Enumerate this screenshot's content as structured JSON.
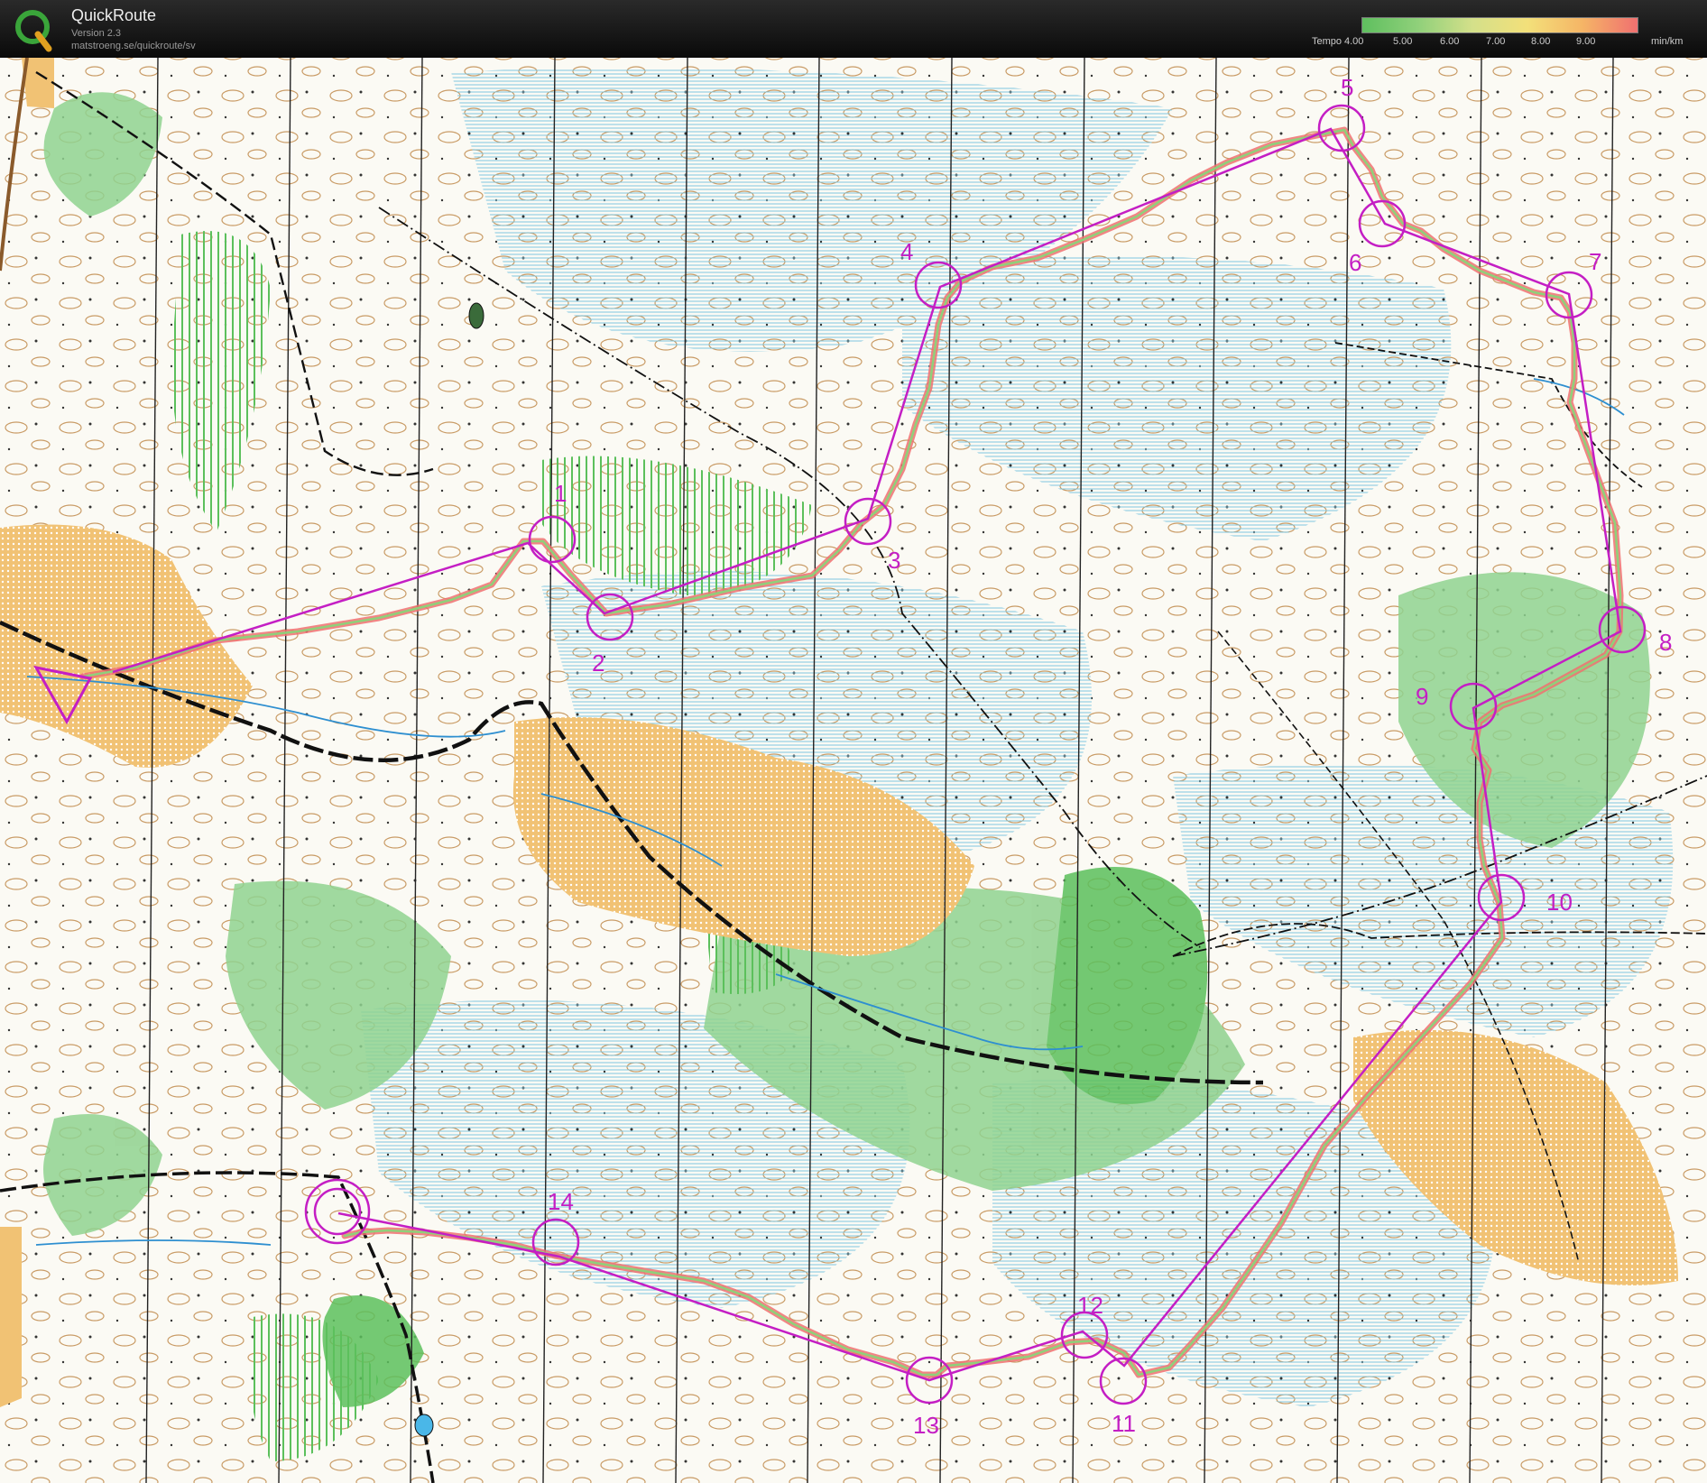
{
  "app": {
    "title": "QuickRoute",
    "version": "Version 2.3",
    "url": "matstroeng.se/quickroute/sv"
  },
  "legend": {
    "title": "Tempo",
    "ticks": [
      "4.00",
      "5.00",
      "6.00",
      "7.00",
      "8.00",
      "9.00"
    ],
    "unit": "min/km",
    "colors": [
      "#5fbf5f",
      "#8fd07a",
      "#d4e08a",
      "#f3e07a",
      "#f5b566",
      "#f07070"
    ]
  },
  "colors": {
    "course": "#c41ec4",
    "paper": "#fbfaf4",
    "contour": "#c08a4c",
    "marsh": "#7fc6e0",
    "open_land": "#f1c274",
    "green_vegetation": "#8fd28f",
    "road": "#111111"
  },
  "controls": [
    "1",
    "2",
    "3",
    "4",
    "5",
    "6",
    "7",
    "8",
    "9",
    "10",
    "11",
    "12",
    "13",
    "14"
  ]
}
